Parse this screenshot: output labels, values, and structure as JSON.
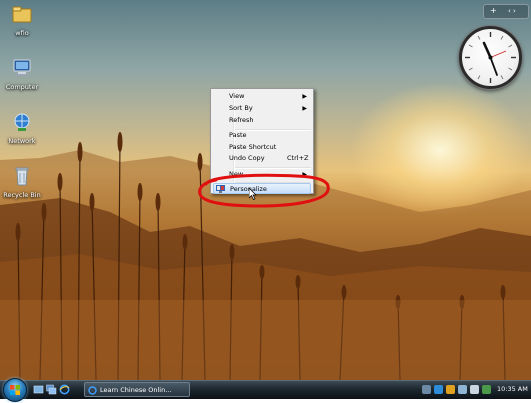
{
  "desktop_icons": [
    {
      "label": "wfio",
      "icon": "folder-icon"
    },
    {
      "label": "Computer",
      "icon": "computer-icon"
    },
    {
      "label": "Network",
      "icon": "network-icon"
    },
    {
      "label": "Recycle Bin",
      "icon": "recycle-bin-icon"
    }
  ],
  "sidebar": {
    "add_glyph": "+",
    "nav_glyph": "‹ ›"
  },
  "context_menu": {
    "items": [
      {
        "label": "View",
        "submenu": true
      },
      {
        "label": "Sort By",
        "submenu": true
      },
      {
        "label": "Refresh"
      },
      {
        "label": "Paste"
      },
      {
        "label": "Paste Shortcut"
      },
      {
        "label": "Undo Copy",
        "shortcut": "Ctrl+Z"
      },
      {
        "label": "New",
        "submenu": true
      },
      {
        "label": "Personalize",
        "icon": "personalize-icon",
        "highlighted": true
      }
    ],
    "arrow": "▶"
  },
  "annotation": {
    "color": "#e01010"
  },
  "taskbar": {
    "task_button_label": "Learn Chinese Onlin...",
    "clock_time": "10:35 AM"
  },
  "colors": {
    "accent": "#2a7fbe",
    "highlight": "#c7defb"
  }
}
